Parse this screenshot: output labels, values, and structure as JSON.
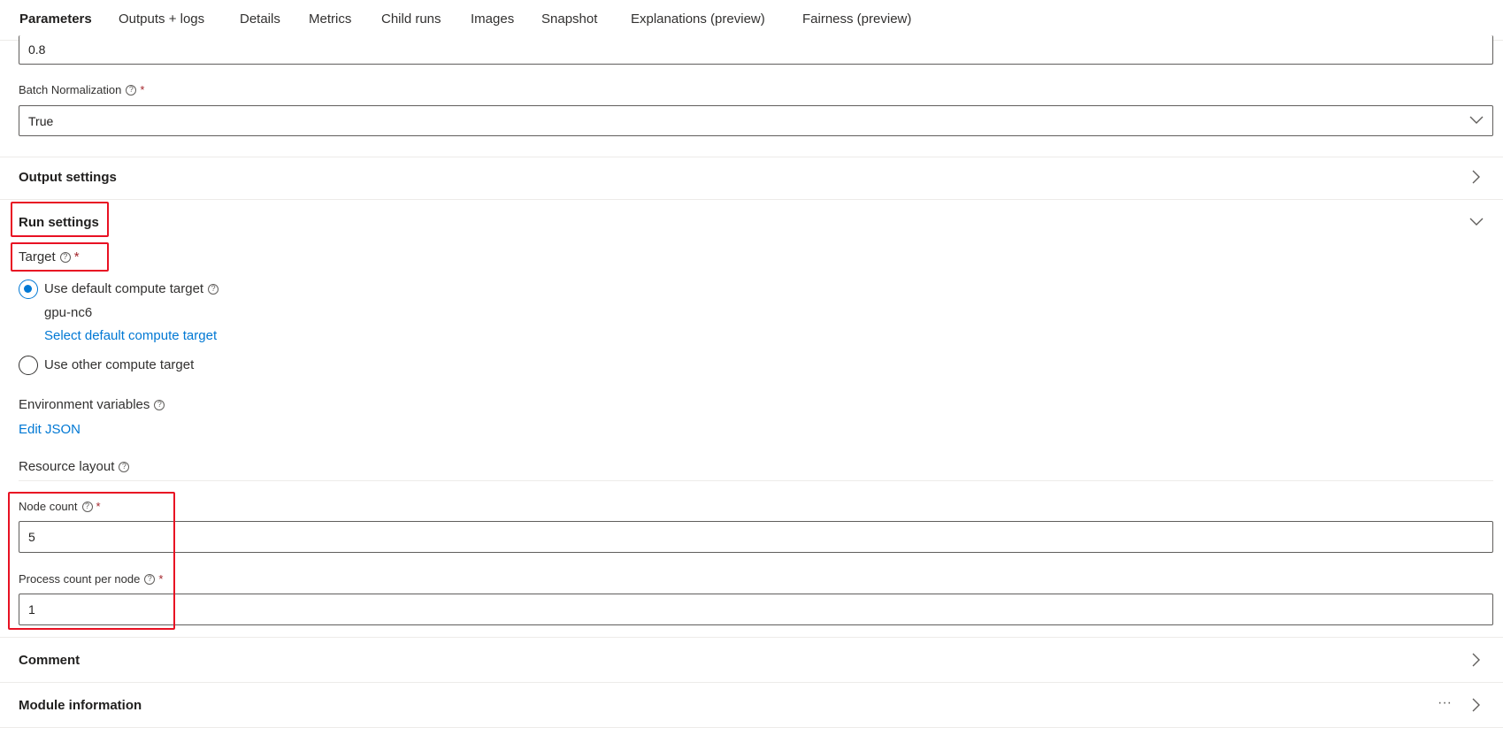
{
  "tabs": [
    {
      "label": "Parameters"
    },
    {
      "label": "Outputs + logs"
    },
    {
      "label": "Details"
    },
    {
      "label": "Metrics"
    },
    {
      "label": "Child runs"
    },
    {
      "label": "Images"
    },
    {
      "label": "Snapshot"
    },
    {
      "label": "Explanations (preview)"
    },
    {
      "label": "Fairness (preview)"
    }
  ],
  "fields": {
    "top_partial_value": "0.8",
    "batch_norm": {
      "label": "Batch Normalization",
      "value": "True"
    }
  },
  "sections": {
    "output_settings": "Output settings",
    "run_settings": "Run settings",
    "comment": "Comment",
    "module_information": "Module information"
  },
  "run_settings": {
    "target_label": "Target",
    "use_default_label": "Use default compute target",
    "default_target_name": "gpu-nc6",
    "select_default_link": "Select default compute target",
    "use_other_label": "Use other compute target",
    "env_vars_label": "Environment variables",
    "edit_json_link": "Edit JSON",
    "resource_layout_label": "Resource layout",
    "node_count_label": "Node count",
    "node_count_value": "5",
    "process_count_label": "Process count per node",
    "process_count_value": "1"
  },
  "symbols": {
    "required": "*",
    "help": "?",
    "more": "···"
  },
  "colors": {
    "accent": "#0078d4",
    "required": "#a4262c",
    "highlight": "#e81123"
  }
}
